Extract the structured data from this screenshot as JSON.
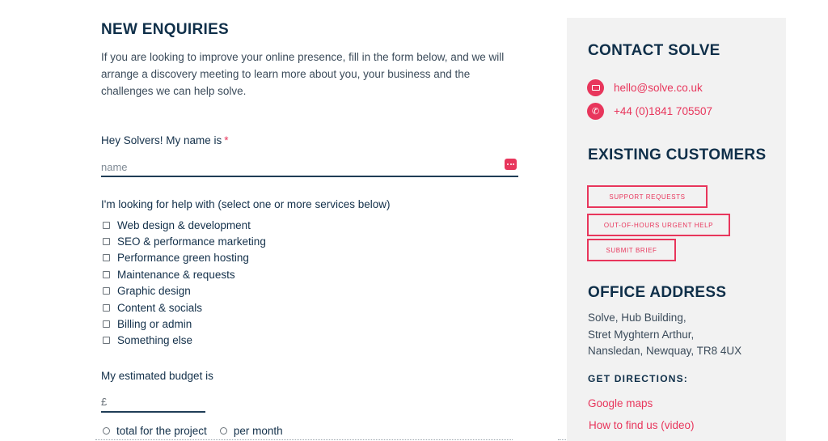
{
  "enquiry": {
    "title": "NEW ENQUIRIES",
    "intro": "If you are looking to improve your online presence, fill in the form below, and we will arrange a discovery meeting to learn more about you, your business and the challenges we can help solve.",
    "name_label": "Hey Solvers! My name is",
    "required_mark": "*",
    "name_placeholder": "name",
    "services_label": "I'm looking for help with (select one or more services below)",
    "services": [
      "Web design & development",
      "SEO & performance marketing",
      "Performance green hosting",
      "Maintenance & requests",
      "Graphic design",
      "Content & socials",
      "Billing or admin",
      "Something else"
    ],
    "budget_label": "My estimated budget is",
    "currency_symbol": "£",
    "budget_options": [
      "total for the project",
      "per month"
    ]
  },
  "sidebar": {
    "contact_title": "CONTACT SOLVE",
    "email": "hello@solve.co.uk",
    "phone": "+44 (0)1841 705507",
    "customers_title": "EXISTING CUSTOMERS",
    "buttons": [
      "SUPPORT REQUESTS",
      "OUT-OF-HOURS URGENT HELP",
      "SUBMIT BRIEF"
    ],
    "office_title": "OFFICE ADDRESS",
    "address": [
      "Solve, Hub Building,",
      "Stret Myghtern Arthur,",
      "Nansledan, Newquay, TR8 4UX"
    ],
    "directions_title": "GET DIRECTIONS:",
    "links": [
      "Google maps",
      "How to find us (video)"
    ]
  },
  "colors": {
    "accent": "#e8365c",
    "heading": "#0f2f49",
    "sidebar_bg": "#f2f2f2"
  }
}
